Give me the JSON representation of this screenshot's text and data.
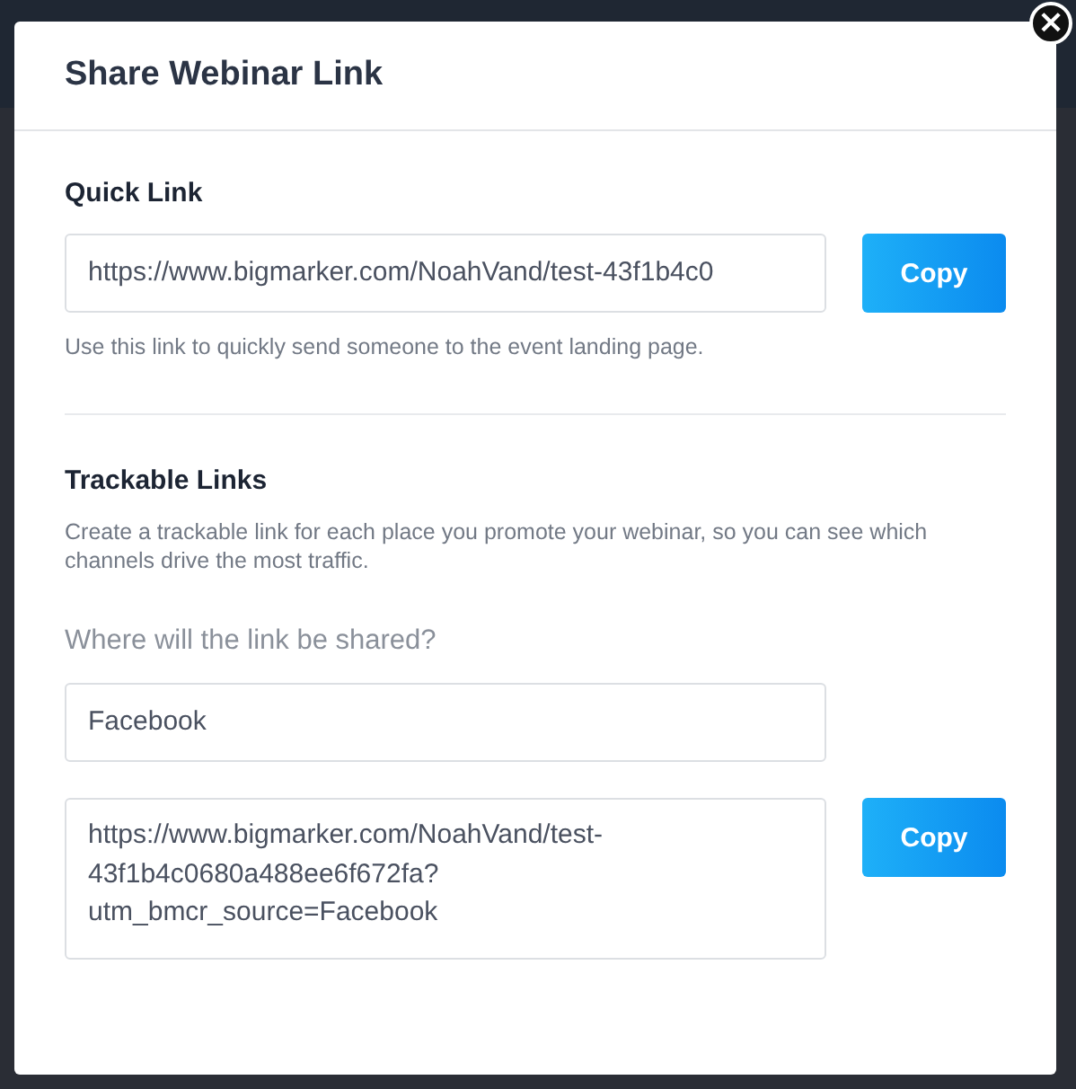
{
  "dialog": {
    "title": "Share Webinar Link",
    "close_label": "×"
  },
  "quick_link": {
    "heading": "Quick Link",
    "url": "https://www.bigmarker.com/NoahVand/test-43f1b4c0",
    "button": "Copy",
    "help": "Use this link to quickly send someone to the event landing page."
  },
  "trackable_links": {
    "heading": "Trackable Links",
    "description": "Create a trackable link for each place you promote your webinar, so you can see which channels drive the most traffic.",
    "question": "Where will the link be shared?",
    "channel": "Facebook",
    "generated_link_lines": [
      "https://www.bigmarker.com/NoahVand/test-",
      "43f1b4c0680a488ee6f672fa?",
      "utm_bmcr_source=Facebook"
    ],
    "button": "Copy"
  }
}
